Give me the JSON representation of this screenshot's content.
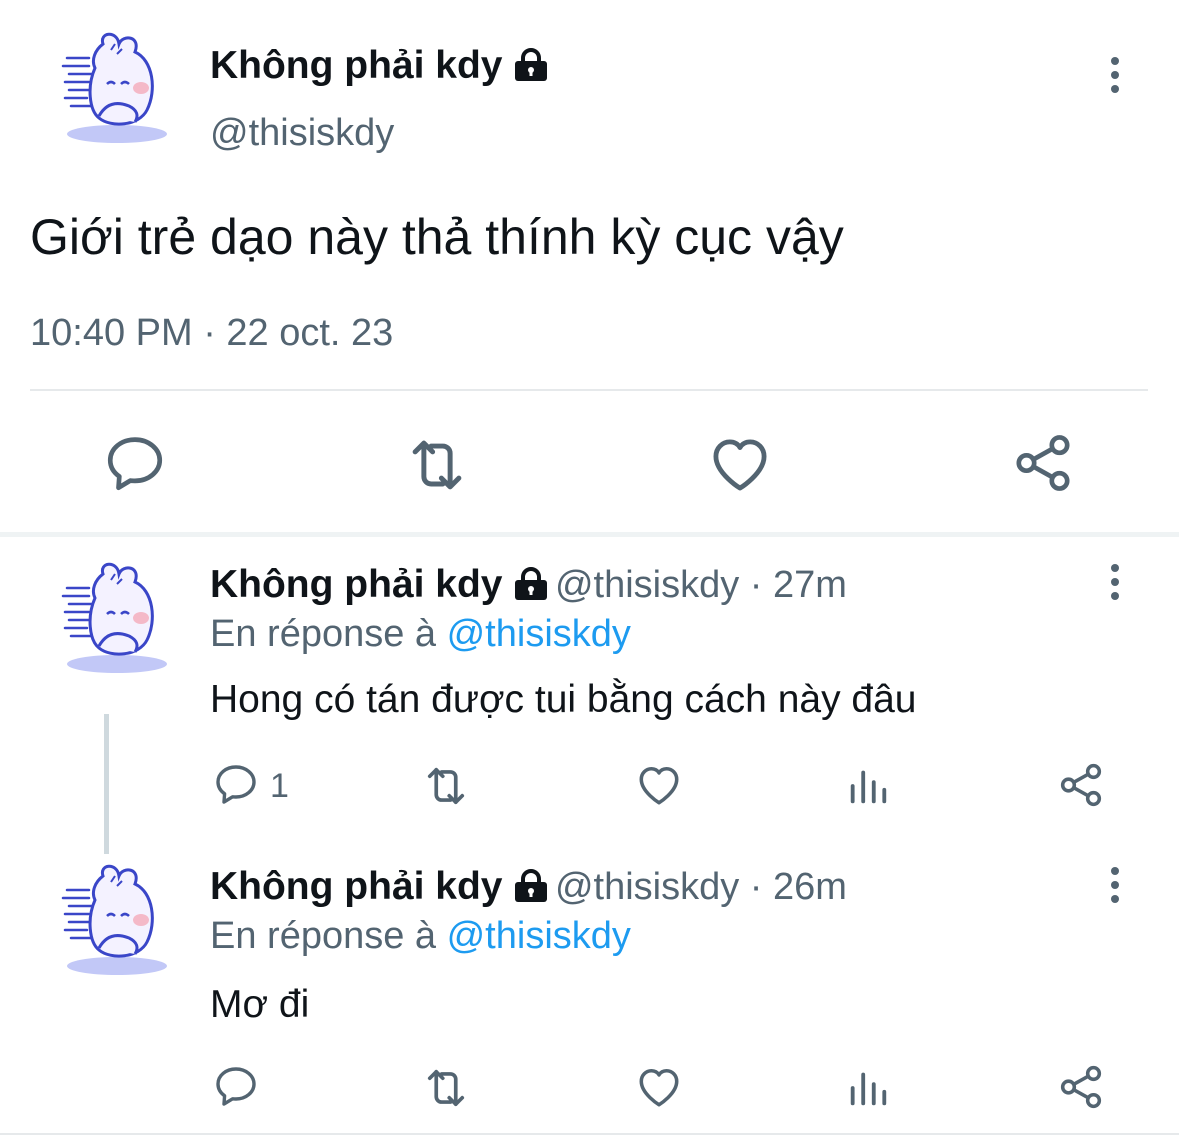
{
  "main_tweet": {
    "display_name": "Không phải kdy",
    "handle": "@thisiskdy",
    "text": "Giới trẻ dạo này thả thính kỳ cục vậy",
    "timestamp": "10:40 PM · 22 oct. 23",
    "actions": [
      "reply-icon",
      "retweet-icon",
      "like-icon",
      "share-icon"
    ]
  },
  "replies": [
    {
      "display_name": "Không phải kdy",
      "handle": "@thisiskdy",
      "separator": " · ",
      "time": "27m",
      "reply_prefix": "En réponse à ",
      "reply_to": "@thisiskdy",
      "text": "Hong có tán được tui bằng cách này đâu",
      "reply_count": "1"
    },
    {
      "display_name": "Không phải kdy",
      "handle": "@thisiskdy",
      "separator": " · ",
      "time": "26m",
      "reply_prefix": "En réponse à ",
      "reply_to": "@thisiskdy",
      "text": "Mơ đi",
      "reply_count": ""
    }
  ],
  "colors": {
    "text_primary": "#0f1419",
    "text_secondary": "#536471",
    "accent": "#1d9bf0",
    "divider": "#e6e9eb"
  }
}
